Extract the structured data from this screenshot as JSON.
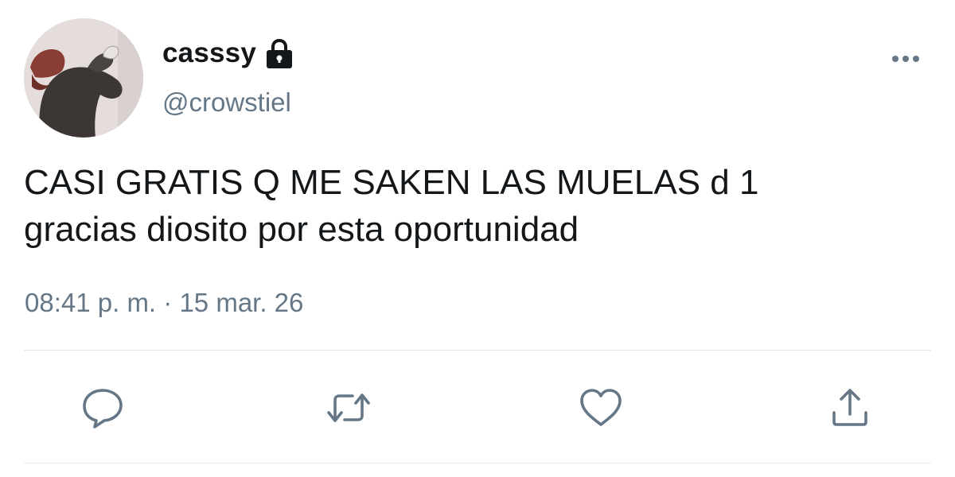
{
  "user": {
    "display_name": "casssy",
    "handle": "@crowstiel",
    "protected_icon": "lock-icon",
    "avatar_icon": "avatar"
  },
  "tweet": {
    "text": "CASI GRATIS Q ME SAKEN LAS MUELAS d 1\ngracias diosito por esta oportunidad",
    "time": "08:41 p. m.",
    "separator": "·",
    "date": "15 mar. 26"
  },
  "actions": [
    {
      "name": "reply",
      "icon": "reply-icon"
    },
    {
      "name": "retweet",
      "icon": "retweet-icon"
    },
    {
      "name": "like",
      "icon": "heart-icon"
    },
    {
      "name": "share",
      "icon": "share-icon"
    }
  ],
  "more_icon": "more-icon",
  "colors": {
    "text": "#14171a",
    "secondary": "#657786",
    "divider": "#e1e8ed"
  }
}
